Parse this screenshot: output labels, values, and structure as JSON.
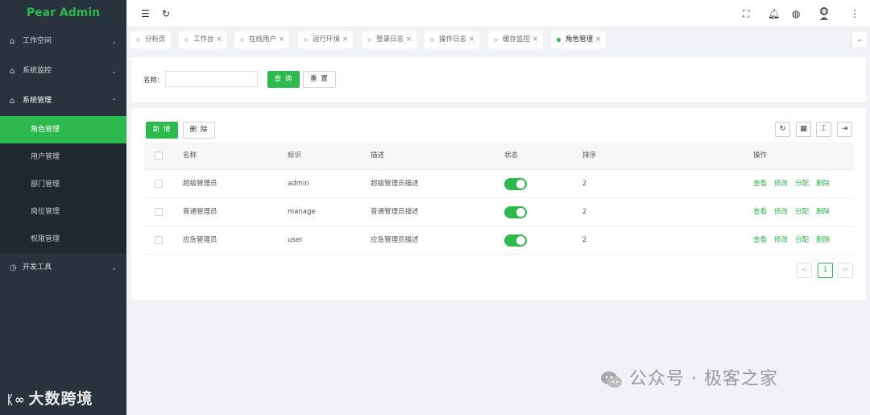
{
  "app": {
    "logo": "Pear Admin"
  },
  "sidebar": {
    "items": [
      {
        "label": "工作空间",
        "icon": "home-icon",
        "arrow": "⌄"
      },
      {
        "label": "系统监控",
        "icon": "home-icon",
        "arrow": "⌄"
      },
      {
        "label": "系统管理",
        "icon": "home-icon",
        "arrow": "⌃"
      }
    ],
    "subitems": [
      {
        "label": "角色管理",
        "active": true
      },
      {
        "label": "用户管理"
      },
      {
        "label": "部门管理"
      },
      {
        "label": "岗位管理"
      },
      {
        "label": "权限管理"
      }
    ],
    "dev": {
      "label": "开发工具",
      "arrow": "⌄"
    }
  },
  "tabs": [
    {
      "label": "分析页",
      "close": ""
    },
    {
      "label": "工作台",
      "close": "×"
    },
    {
      "label": "在线用户",
      "close": "×"
    },
    {
      "label": "运行环境",
      "close": "×"
    },
    {
      "label": "登录日志",
      "close": "×"
    },
    {
      "label": "操作日志",
      "close": "×"
    },
    {
      "label": "缓存监控",
      "close": "×"
    },
    {
      "label": "角色管理",
      "close": "×"
    }
  ],
  "search": {
    "label": "名称:",
    "value": "",
    "placeholder": "",
    "query_label": "查 询",
    "reset_label": "重 置"
  },
  "toolbar": {
    "add_label": "新 增",
    "delete_label": "删 除"
  },
  "table": {
    "headers": {
      "name": "名称",
      "code": "标识",
      "desc": "描述",
      "status": "状态",
      "sort": "排序",
      "ops": "操作"
    },
    "rows": [
      {
        "name": "超级管理员",
        "code": "admin",
        "desc": "超级管理员描述",
        "enabled": true,
        "sort": "2"
      },
      {
        "name": "普通管理员",
        "code": "manage",
        "desc": "普通管理员描述",
        "enabled": true,
        "sort": "2"
      },
      {
        "name": "应急管理员",
        "code": "user",
        "desc": "应急管理员描述",
        "enabled": true,
        "sort": "2"
      }
    ],
    "ops": {
      "view": "查看",
      "edit": "修改",
      "assign": "分配",
      "remove": "删除"
    }
  },
  "pagination": {
    "prev": "<",
    "current": "1",
    "next": ">"
  },
  "watermark": {
    "left": "大数跨境",
    "right": "公众号 · 极客之家"
  },
  "colors": {
    "accent": "#2db94d",
    "sidebar": "#28333e"
  }
}
